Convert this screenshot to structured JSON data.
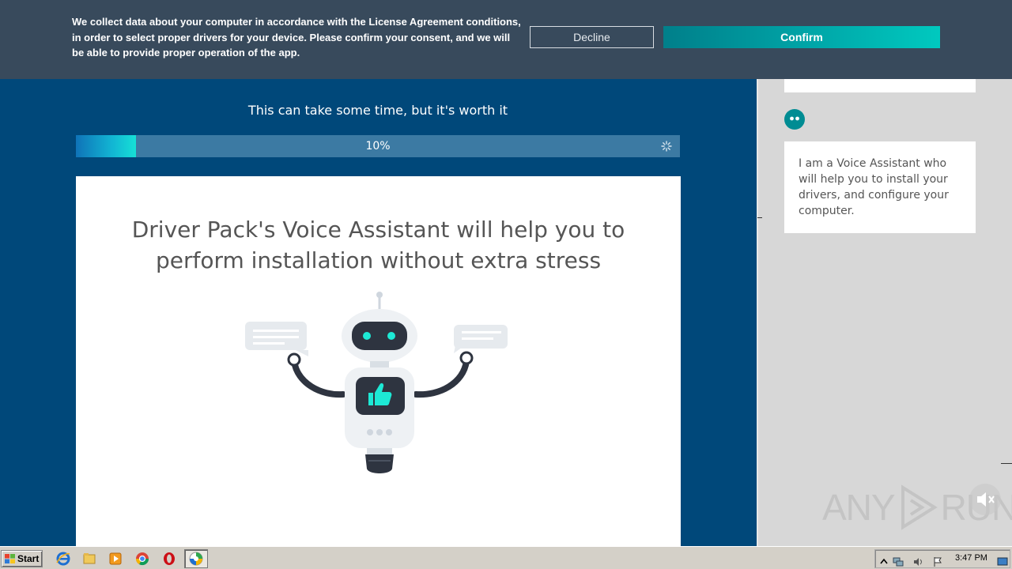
{
  "consent": {
    "text": "We collect data about your computer in accordance with the License Agreement conditions, in order to select proper drivers for your device. Please confirm your consent, and we will be able to provide proper operation of the app.",
    "decline_label": "Decline",
    "confirm_label": "Confirm"
  },
  "main": {
    "subtitle": "This can take some time, but it's worth it",
    "progress": {
      "label": "10%",
      "value": 0.1
    },
    "card_heading": "Driver Pack's Voice Assistant will help you to perform installation without extra stress"
  },
  "sidebar": {
    "message": "I am a Voice Assistant who will help you to install your drivers, and configure your computer."
  },
  "watermark": {
    "left": "ANY",
    "right": "RUN"
  },
  "taskbar": {
    "start_label": "Start",
    "clock": "3:47 PM",
    "icons": [
      "ie-icon",
      "explorer-icon",
      "media-player-icon",
      "chrome-icon",
      "opera-icon",
      "driverpack-icon"
    ]
  },
  "colors": {
    "main_bg": "#00487a",
    "banner_bg": "#384a5c",
    "accent": "#00c9bf",
    "sidebar_bg": "#d7d7d7"
  }
}
